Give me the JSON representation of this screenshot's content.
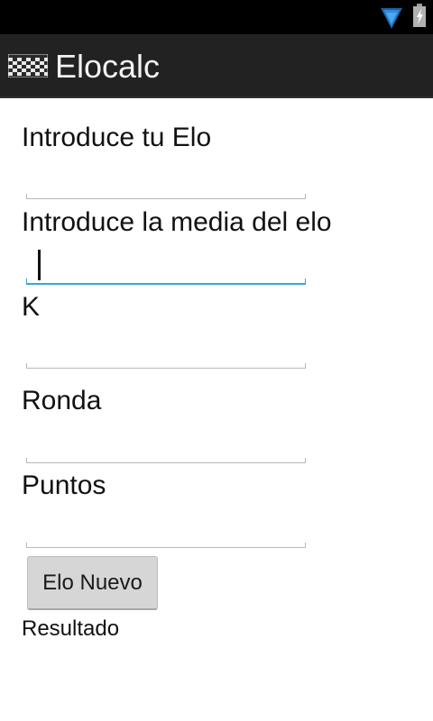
{
  "status_bar": {
    "wifi_icon": "wifi-signal-icon",
    "battery_icon": "battery-charging-icon"
  },
  "action_bar": {
    "app_icon": "chessboard-icon",
    "title": "Elocalc"
  },
  "form": {
    "elo_label": "Introduce tu Elo",
    "elo_value": "",
    "media_label": "Introduce la media del elo",
    "media_value": "",
    "k_label": "K",
    "k_value": "",
    "ronda_label": "Ronda",
    "ronda_value": "",
    "puntos_label": "Puntos",
    "puntos_value": "",
    "calculate_button_label": "Elo Nuevo",
    "result_text": "Resultado"
  },
  "colors": {
    "status_bar_bg": "#000000",
    "action_bar_bg": "#222222",
    "focus_accent": "#33a8d8",
    "field_line": "#b8b8b8",
    "button_bg": "#d6d6d6"
  }
}
